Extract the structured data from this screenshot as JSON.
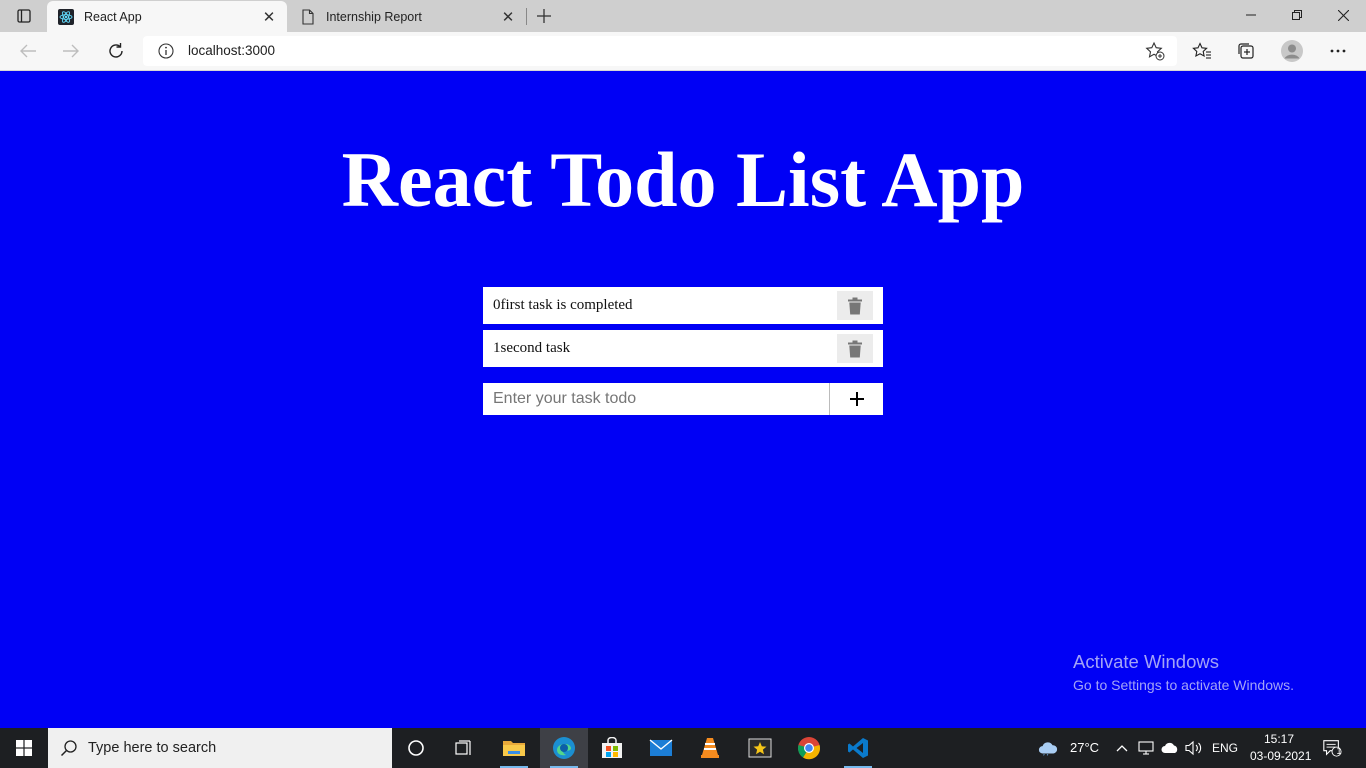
{
  "browser": {
    "tabs": [
      {
        "title": "React App",
        "icon": "react-logo-icon",
        "active": true
      },
      {
        "title": "Internship Report",
        "icon": "document-icon",
        "active": false
      }
    ],
    "address": {
      "url": "localhost:3000"
    },
    "window_controls": [
      "minimize",
      "restore",
      "close"
    ]
  },
  "page": {
    "title": "React Todo List App",
    "todos": [
      {
        "text": "0first task is completed"
      },
      {
        "text": "1second task"
      }
    ],
    "input": {
      "placeholder": "Enter your task todo",
      "value": ""
    },
    "add_icon": "plus-icon",
    "delete_icon": "trash-icon",
    "background_color": "#0000f5"
  },
  "watermark": {
    "line1": "Activate Windows",
    "line2": "Go to Settings to activate Windows."
  },
  "taskbar": {
    "search_placeholder": "Type here to search",
    "apps": [
      "cortana",
      "task-view",
      "file-explorer",
      "edge",
      "microsoft-store",
      "mail",
      "vlc",
      "video-editor",
      "chrome",
      "vscode"
    ],
    "active_app": "edge",
    "weather": "27°C",
    "language": "ENG",
    "time": "15:17",
    "date": "03-09-2021",
    "notification_count": "1"
  }
}
